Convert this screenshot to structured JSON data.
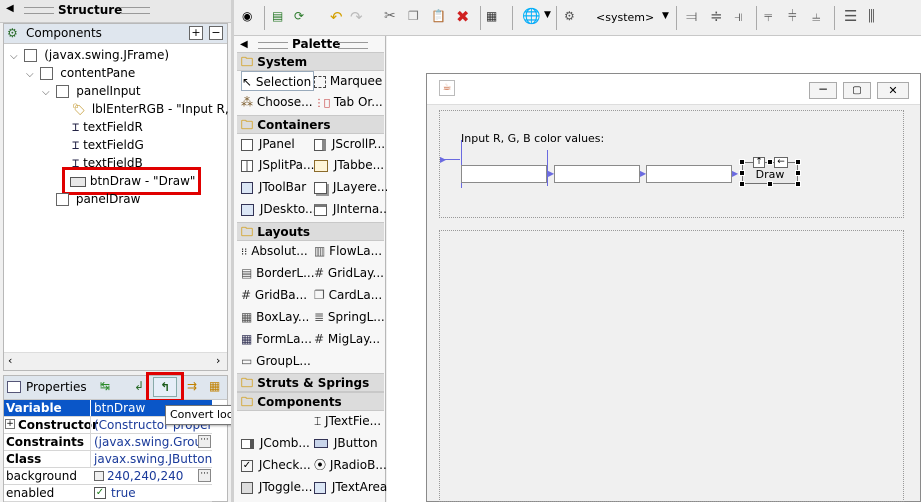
{
  "structure": {
    "title": "Structure"
  },
  "components": {
    "title": "Components",
    "tree": [
      {
        "label": "(javax.swing.JFrame)"
      },
      {
        "label": "contentPane"
      },
      {
        "label": "panelInput"
      },
      {
        "label": "lblEnterRGB - \"Input R, G,"
      },
      {
        "label": "textFieldR"
      },
      {
        "label": "textFieldG"
      },
      {
        "label": "textFieldB"
      },
      {
        "label": "btnDraw - \"Draw\""
      },
      {
        "label": "panelDraw"
      }
    ]
  },
  "properties": {
    "title": "Properties",
    "tooltip": "Convert local to field",
    "rows": [
      {
        "key": "Variable",
        "value": "btnDraw"
      },
      {
        "key": "Constructor",
        "value": "(Constructor propert..."
      },
      {
        "key": "Constraints",
        "value": "(javax.swing.Grou..."
      },
      {
        "key": "Class",
        "value": "javax.swing.JButton"
      },
      {
        "key": "background",
        "value": "240,240,240"
      },
      {
        "key": "enabled",
        "value": "true"
      }
    ]
  },
  "toolbar": {
    "system_label": "<system>"
  },
  "palette": {
    "title": "Palette",
    "sections": [
      {
        "name": "System",
        "items": [
          "Selection",
          "Marquee",
          "Choose...",
          "Tab Or..."
        ]
      },
      {
        "name": "Containers",
        "items": [
          "JPanel",
          "JScrollP...",
          "JSplitPa...",
          "JTabbe...",
          "JToolBar",
          "JLayere...",
          "JDeskto...",
          "JInterna..."
        ]
      },
      {
        "name": "Layouts",
        "items": [
          "Absolut...",
          "FlowLa...",
          "BorderL...",
          "GridLay...",
          "GridBa...",
          "CardLa...",
          "BoxLay...",
          "SpringL...",
          "FormLa...",
          "MigLay...",
          "GroupL..."
        ]
      },
      {
        "name": "Struts & Springs",
        "items": []
      },
      {
        "name": "Components",
        "items": [
          "JTextFie...",
          "JComb...",
          "JButton",
          "JCheck...",
          "JRadioB...",
          "JToggle...",
          "JTextArea"
        ]
      }
    ]
  },
  "designer": {
    "label_text": "Input R, G, B color values:",
    "button_text": "Draw"
  },
  "colors": {
    "highlight": "#e00000",
    "selection": "#0a56c8",
    "guide": "#6a6ae0"
  }
}
